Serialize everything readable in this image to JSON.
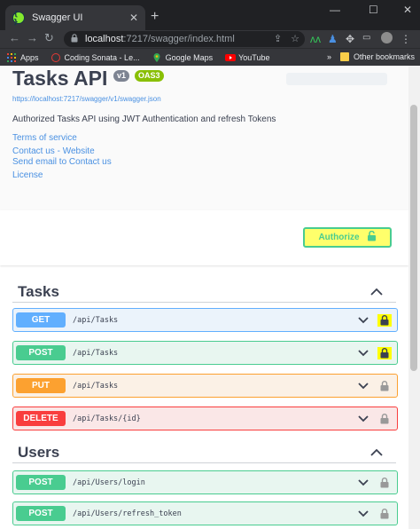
{
  "browser": {
    "tab_title": "Swagger UI",
    "tab_close": "✕",
    "new_tab": "+",
    "window_controls": {
      "minimize": "—",
      "maximize": "☐",
      "close": "✕"
    },
    "url_host": "localhost",
    "url_path": ":7217/swagger/index.html",
    "bookmarks": [
      {
        "label": "Apps"
      },
      {
        "label": "Coding Sonata - Le..."
      },
      {
        "label": "Google Maps"
      },
      {
        "label": "YouTube"
      }
    ],
    "overflow": "»",
    "other_bookmarks": "Other bookmarks"
  },
  "info": {
    "title": "Tasks API",
    "version_badge": "v1",
    "oas_badge": "OAS3",
    "spec_url": "https://localhost:7217/swagger/v1/swagger.json",
    "description": "Authorized Tasks API using JWT Authentication and refresh Tokens",
    "links": {
      "terms": "Terms of service",
      "website": "Contact us - Website",
      "email": "Send email to Contact us",
      "license": "License"
    }
  },
  "authorize_label": "Authorize",
  "sections": {
    "tasks": {
      "name": "Tasks",
      "ops": [
        {
          "method": "GET",
          "path": "/api/Tasks"
        },
        {
          "method": "POST",
          "path": "/api/Tasks"
        },
        {
          "method": "PUT",
          "path": "/api/Tasks"
        },
        {
          "method": "DELETE",
          "path": "/api/Tasks/{id}"
        }
      ]
    },
    "users": {
      "name": "Users",
      "ops": [
        {
          "method": "POST",
          "path": "/api/Users/login"
        },
        {
          "method": "POST",
          "path": "/api/Users/refresh_token"
        }
      ]
    }
  },
  "colors": {
    "get": "#61affe",
    "post": "#49cc90",
    "put": "#fca130",
    "delete": "#f93e3e",
    "highlight": "#ffff00"
  },
  "icons": {
    "favicon": "swagger-favicon",
    "lock": "lock-icon",
    "chevron_up": "chevron-up-icon",
    "chevron_down": "chevron-down-icon"
  }
}
